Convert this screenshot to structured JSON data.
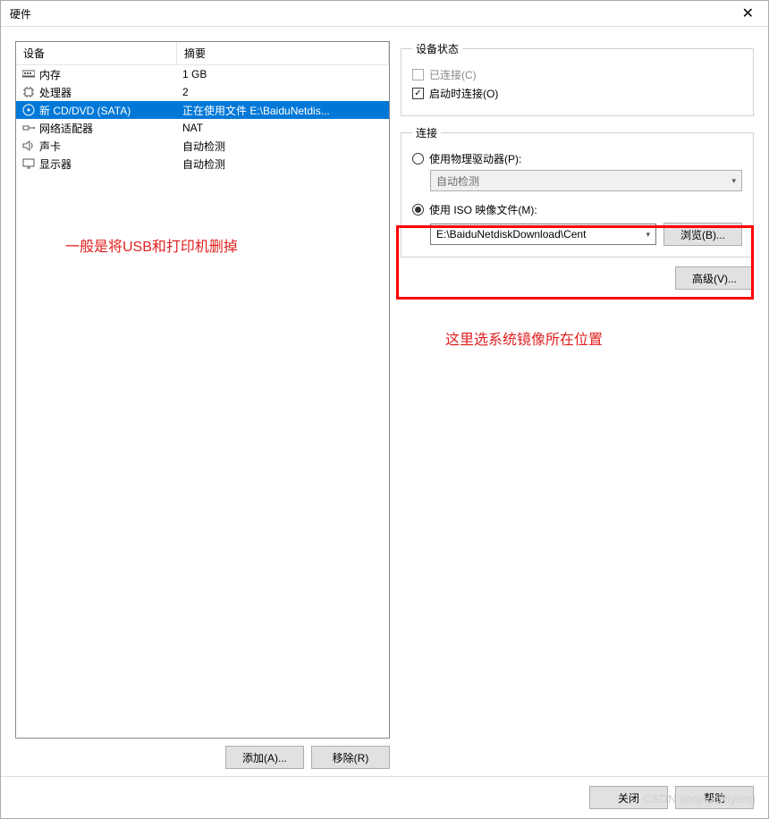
{
  "window": {
    "title": "硬件"
  },
  "columns": {
    "device": "设备",
    "summary": "摘要"
  },
  "devices": [
    {
      "icon": "memory-icon",
      "name": "内存",
      "summary": "1 GB"
    },
    {
      "icon": "cpu-icon",
      "name": "处理器",
      "summary": "2"
    },
    {
      "icon": "disc-icon",
      "name": "新 CD/DVD (SATA)",
      "summary": "正在使用文件 E:\\BaiduNetdis...",
      "selected": true
    },
    {
      "icon": "network-icon",
      "name": "网络适配器",
      "summary": "NAT"
    },
    {
      "icon": "sound-icon",
      "name": "声卡",
      "summary": "自动检测"
    },
    {
      "icon": "display-icon",
      "name": "显示器",
      "summary": "自动检测"
    }
  ],
  "annotations": {
    "left": "一般是将USB和打印机删掉",
    "right": "这里选系统镜像所在位置"
  },
  "buttons": {
    "add": "添加(A)...",
    "remove": "移除(R)",
    "browse": "浏览(B)...",
    "advanced": "高级(V)...",
    "close": "关闭",
    "help": "帮助"
  },
  "device_status": {
    "legend": "设备状态",
    "connected": "已连接(C)",
    "connect_on_start": "启动时连接(O)"
  },
  "connection": {
    "legend": "连接",
    "physical": "使用物理驱动器(P):",
    "physical_value": "自动检测",
    "iso": "使用 ISO 映像文件(M):",
    "iso_value": "E:\\BaiduNetdiskDownload\\Cent"
  },
  "watermark": "CSDN @njnu@liyong"
}
